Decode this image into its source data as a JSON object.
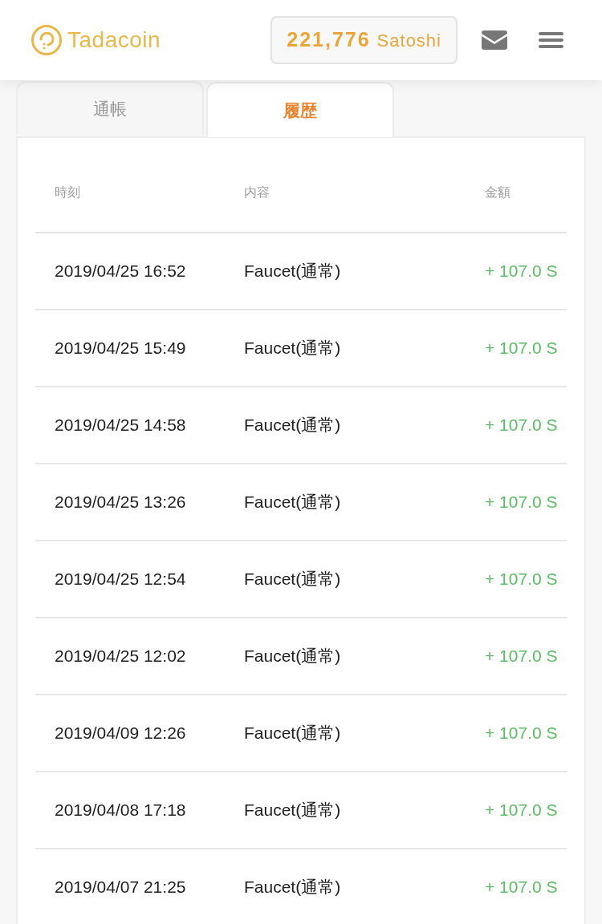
{
  "header": {
    "logo": "Tadacoin",
    "balance": {
      "amount": "221,776",
      "unit": "Satoshi"
    }
  },
  "tabs": [
    {
      "label": "通帳",
      "selected": false
    },
    {
      "label": "履歴",
      "selected": true
    }
  ],
  "table": {
    "columns": [
      "時刻",
      "内容",
      "金額"
    ],
    "rows": [
      {
        "time": "2019/04/25 16:52",
        "description": "Faucet(通常)",
        "amount": "+ 107.0 S"
      },
      {
        "time": "2019/04/25 15:49",
        "description": "Faucet(通常)",
        "amount": "+ 107.0 S"
      },
      {
        "time": "2019/04/25 14:58",
        "description": "Faucet(通常)",
        "amount": "+ 107.0 S"
      },
      {
        "time": "2019/04/25 13:26",
        "description": "Faucet(通常)",
        "amount": "+ 107.0 S"
      },
      {
        "time": "2019/04/25 12:54",
        "description": "Faucet(通常)",
        "amount": "+ 107.0 S"
      },
      {
        "time": "2019/04/25 12:02",
        "description": "Faucet(通常)",
        "amount": "+ 107.0 S"
      },
      {
        "time": "2019/04/09 12:26",
        "description": "Faucet(通常)",
        "amount": "+ 107.0 S"
      },
      {
        "time": "2019/04/08 17:18",
        "description": "Faucet(通常)",
        "amount": "+ 107.0 S"
      },
      {
        "time": "2019/04/07 21:25",
        "description": "Faucet(通常)",
        "amount": "+ 107.0 S"
      }
    ]
  }
}
